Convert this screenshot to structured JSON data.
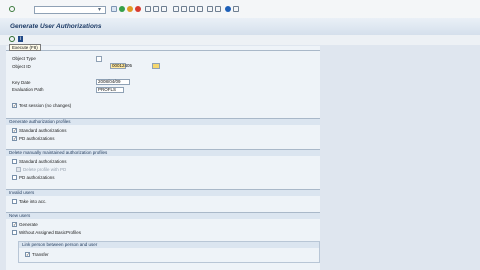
{
  "window": {
    "title": "Generate User Authorizations"
  },
  "tooltip": {
    "text": "Execute (F8)"
  },
  "selection": {
    "object_type_label": "Object Type",
    "object_type_value": "",
    "object_id_label": "Object ID",
    "object_id_value": "00012405",
    "key_date_label": "Key Date",
    "key_date_value": "2008/04/09",
    "eval_path_label": "Evaluation Path",
    "eval_path_value": "PROFLS",
    "test_session_label": "Test session (no changes)"
  },
  "generate_profiles": {
    "title": "Generate authorization profiles",
    "standard_label": "Standard authorizations",
    "pd_label": "PD authorizations"
  },
  "delete_profiles": {
    "title": "Delete manually maintained authorization profiles",
    "standard_label": "Standard authorizations",
    "disabled_label": "Delete profile with PD",
    "pd_label": "PD authorizations"
  },
  "invalid_users": {
    "title": "Invalid users",
    "take_label": "Take into acc."
  },
  "new_users": {
    "title": "New users",
    "generate_label": "Generate",
    "without_label": "Without Assigned BasicProfiles"
  },
  "link_person": {
    "title": "Link person between person and user",
    "transfer_label": "Transfer"
  }
}
